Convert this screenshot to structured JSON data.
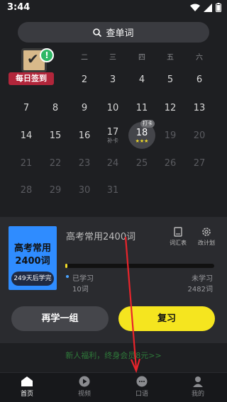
{
  "status_bar": {
    "time": "3:44"
  },
  "search": {
    "label": "查单词"
  },
  "calendar": {
    "weekdays": [
      "",
      "",
      "二",
      "三",
      "四",
      "五",
      "六"
    ],
    "rows": [
      [
        {
          "n": "",
          "dim": false
        },
        {
          "n": "",
          "dim": false
        },
        {
          "n": "2",
          "dim": false
        },
        {
          "n": "3",
          "dim": false
        },
        {
          "n": "4",
          "dim": false
        },
        {
          "n": "5",
          "dim": false
        },
        {
          "n": "6",
          "dim": false
        }
      ],
      [
        {
          "n": "7",
          "dim": false
        },
        {
          "n": "8",
          "dim": false
        },
        {
          "n": "9",
          "dim": false
        },
        {
          "n": "10",
          "dim": false
        },
        {
          "n": "11",
          "dim": false
        },
        {
          "n": "12",
          "dim": false
        },
        {
          "n": "13",
          "dim": false
        }
      ],
      [
        {
          "n": "14",
          "dim": false
        },
        {
          "n": "15",
          "dim": false
        },
        {
          "n": "16",
          "dim": false
        },
        {
          "n": "17",
          "dim": false,
          "sub": "补卡"
        },
        {
          "n": "18",
          "dim": false,
          "today": true
        },
        {
          "n": "19",
          "dim": true
        },
        {
          "n": "20",
          "dim": true
        }
      ],
      [
        {
          "n": "21",
          "dim": true
        },
        {
          "n": "22",
          "dim": true
        },
        {
          "n": "23",
          "dim": true
        },
        {
          "n": "24",
          "dim": true
        },
        {
          "n": "25",
          "dim": true
        },
        {
          "n": "26",
          "dim": true
        },
        {
          "n": "27",
          "dim": true
        }
      ],
      [
        {
          "n": "28",
          "dim": true
        },
        {
          "n": "29",
          "dim": true
        },
        {
          "n": "30",
          "dim": true
        },
        {
          "n": "31",
          "dim": true
        },
        {
          "n": "",
          "dim": true
        },
        {
          "n": "",
          "dim": true
        },
        {
          "n": "",
          "dim": true
        }
      ]
    ],
    "today_badge": "打卡",
    "today_stars": "★★★"
  },
  "checkin": {
    "label": "每日签到",
    "badge": "!"
  },
  "book": {
    "cover_line1": "高考常用",
    "cover_line2": "2400词",
    "days_left": "249天后学完",
    "name": "高考常用2400词",
    "tool_wordlist": "词汇表",
    "tool_plan": "改计划",
    "learned_label": "已学习",
    "learned_count": "10词",
    "unlearned_label": "未学习",
    "unlearned_count": "2482词",
    "progress_fraction": 0.004
  },
  "actions": {
    "again": "再学一组",
    "review": "复习"
  },
  "promo": {
    "text": "新人福利，终身会员8元>>"
  },
  "tabs": [
    {
      "label": "首页",
      "icon": "home-icon",
      "active": true
    },
    {
      "label": "视频",
      "icon": "play-icon",
      "active": false
    },
    {
      "label": "口语",
      "icon": "speech-icon",
      "active": false
    },
    {
      "label": "我的",
      "icon": "user-icon",
      "active": false
    }
  ],
  "colors": {
    "accent": "#f5e51f",
    "background": "#1e1f22",
    "book_blue": "#2f8cff",
    "annotation_arrow": "#e8242b"
  }
}
